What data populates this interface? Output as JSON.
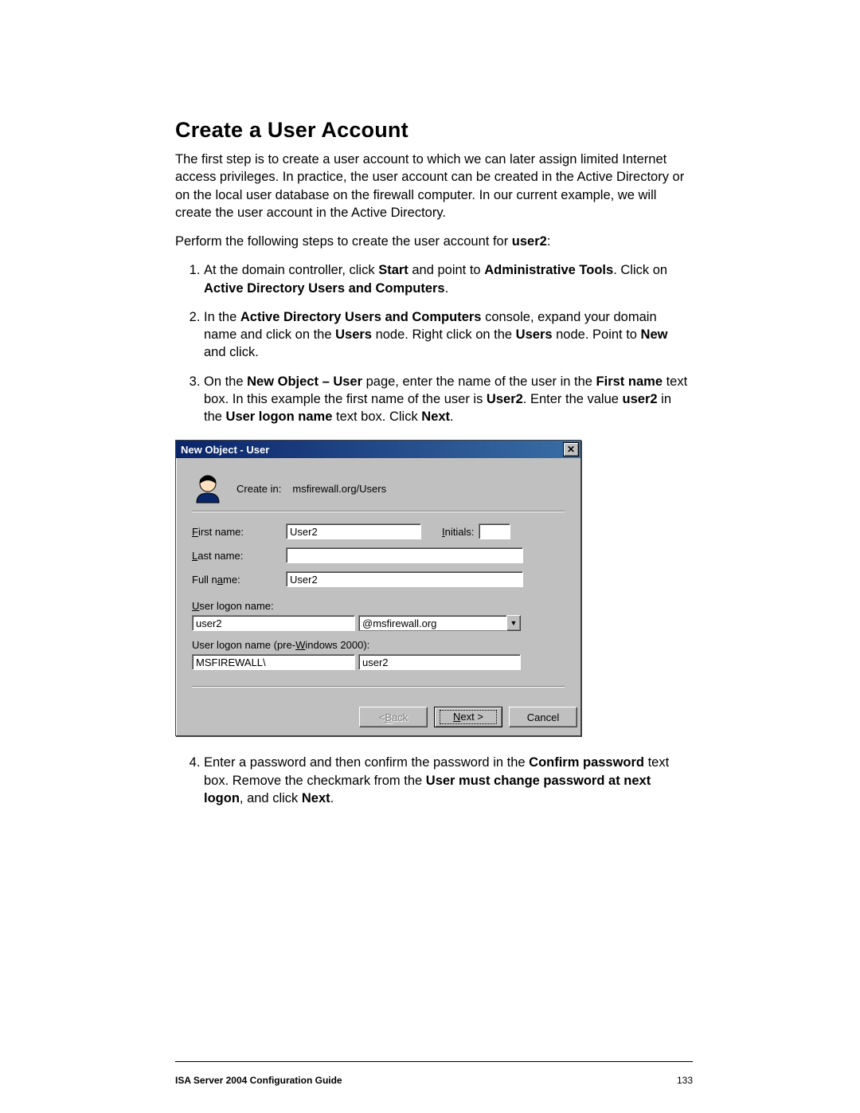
{
  "doc": {
    "heading": "Create a User Account",
    "intro": "The first step is to create a user account to which we can later assign limited Internet access privileges. In practice, the user account can be created in the Active Directory or on the local user database on the firewall computer. In our current example, we will create the user account in the Active Directory.",
    "perform": "Perform the following steps to create the user account for ",
    "perform_bold": "user2",
    "perform_colon": ":",
    "steps": {
      "s1a": "At the domain controller, click ",
      "s1b": "Start",
      "s1c": " and point to ",
      "s1d": "Administrative Tools",
      "s1e": ". Click on ",
      "s1f": "Active Directory Users and Computers",
      "s1g": ".",
      "s2a": "In the ",
      "s2b": "Active Directory Users and Computers",
      "s2c": " console, expand your domain name and click on the ",
      "s2d": "Users",
      "s2e": " node. Right click on the ",
      "s2f": "Users",
      "s2g": " node. Point to ",
      "s2h": "New",
      "s2i": " and click.",
      "s3a": "On the ",
      "s3b": "New Object – User",
      "s3c": " page, enter the name of the user in the ",
      "s3d": "First name",
      "s3e": " text box. In this example the first name of the user is ",
      "s3f": "User2",
      "s3g": ". Enter the value ",
      "s3h": "user2",
      "s3i": " in the ",
      "s3j": "User logon name",
      "s3k": " text box. Click ",
      "s3l": "Next",
      "s3m": ".",
      "s4a": "Enter a password and then confirm the password in the ",
      "s4b": "Confirm password",
      "s4c": " text box. Remove the checkmark from the ",
      "s4d": "User must change password at next logon",
      "s4e": ", and click ",
      "s4f": "Next",
      "s4g": "."
    },
    "footer_title": "ISA Server 2004 Configuration Guide",
    "footer_page": "133"
  },
  "dialog": {
    "title": "New Object - User",
    "create_in_label": "Create in:",
    "create_in_path": "msfirewall.org/Users",
    "labels": {
      "first_name": "First name:",
      "initials": "Initials:",
      "last_name": "Last name:",
      "full_name": "Full name:",
      "logon_name": "User logon name:",
      "logon_pre2k": "User logon name (pre-Windows 2000):"
    },
    "values": {
      "first_name": "User2",
      "initials": "",
      "last_name": "",
      "full_name": "User2",
      "logon": "user2",
      "domain_suffix": "@msfirewall.org",
      "pre2k_domain": "MSFIREWALL\\",
      "pre2k_name": "user2"
    },
    "buttons": {
      "back": "< Back",
      "next": "Next >",
      "cancel": "Cancel"
    }
  }
}
